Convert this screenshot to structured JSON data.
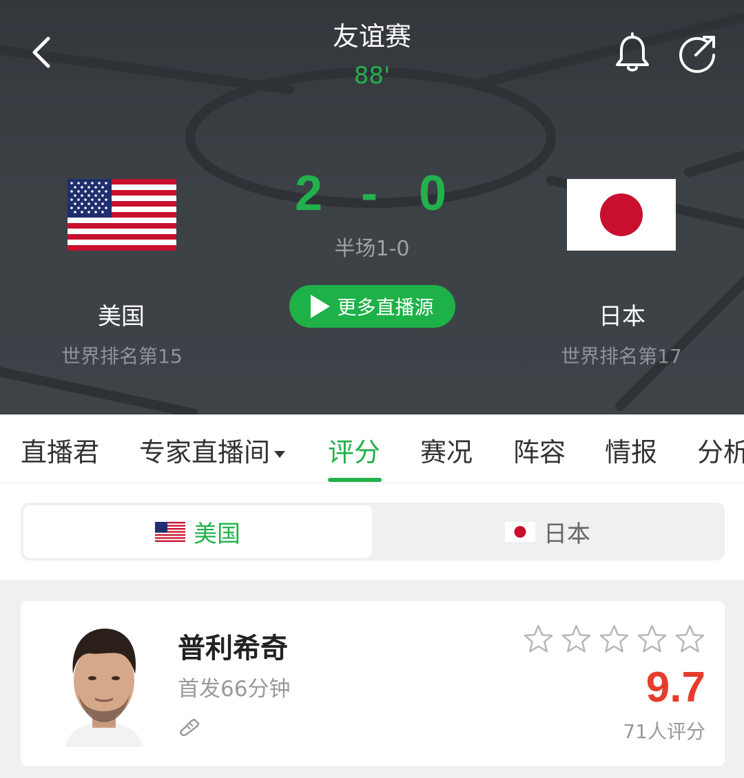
{
  "header": {
    "match_title": "友谊赛",
    "minute": "88'",
    "score": {
      "home": "2",
      "separator": "-",
      "away": "0"
    },
    "halftime": "半场1-0",
    "live_button_label": "更多直播源",
    "home_team": {
      "name": "美国",
      "rank": "世界排名第15",
      "flag": "us-flag"
    },
    "away_team": {
      "name": "日本",
      "rank": "世界排名第17",
      "flag": "jp-flag"
    },
    "icons": [
      "back-arrow-icon",
      "bell-icon",
      "share-icon"
    ]
  },
  "tabs": [
    {
      "label": "直播君",
      "active": false
    },
    {
      "label": "专家直播间",
      "active": false,
      "has_dropdown": true
    },
    {
      "label": "评分",
      "active": true
    },
    {
      "label": "赛况",
      "active": false
    },
    {
      "label": "阵容",
      "active": false
    },
    {
      "label": "情报",
      "active": false
    },
    {
      "label": "分析",
      "active": false
    }
  ],
  "team_switch": {
    "home_label": "美国",
    "away_label": "日本",
    "selected": "home"
  },
  "player": {
    "name": "普利希奇",
    "sub": "首发66分钟",
    "rating": "9.7",
    "rating_count": "71人评分",
    "stars_filled": 0,
    "stars_total": 5
  },
  "colors": {
    "accent_green": "#22b14c",
    "rating_red": "#e63c2e",
    "header_bg": "#3c4146"
  }
}
